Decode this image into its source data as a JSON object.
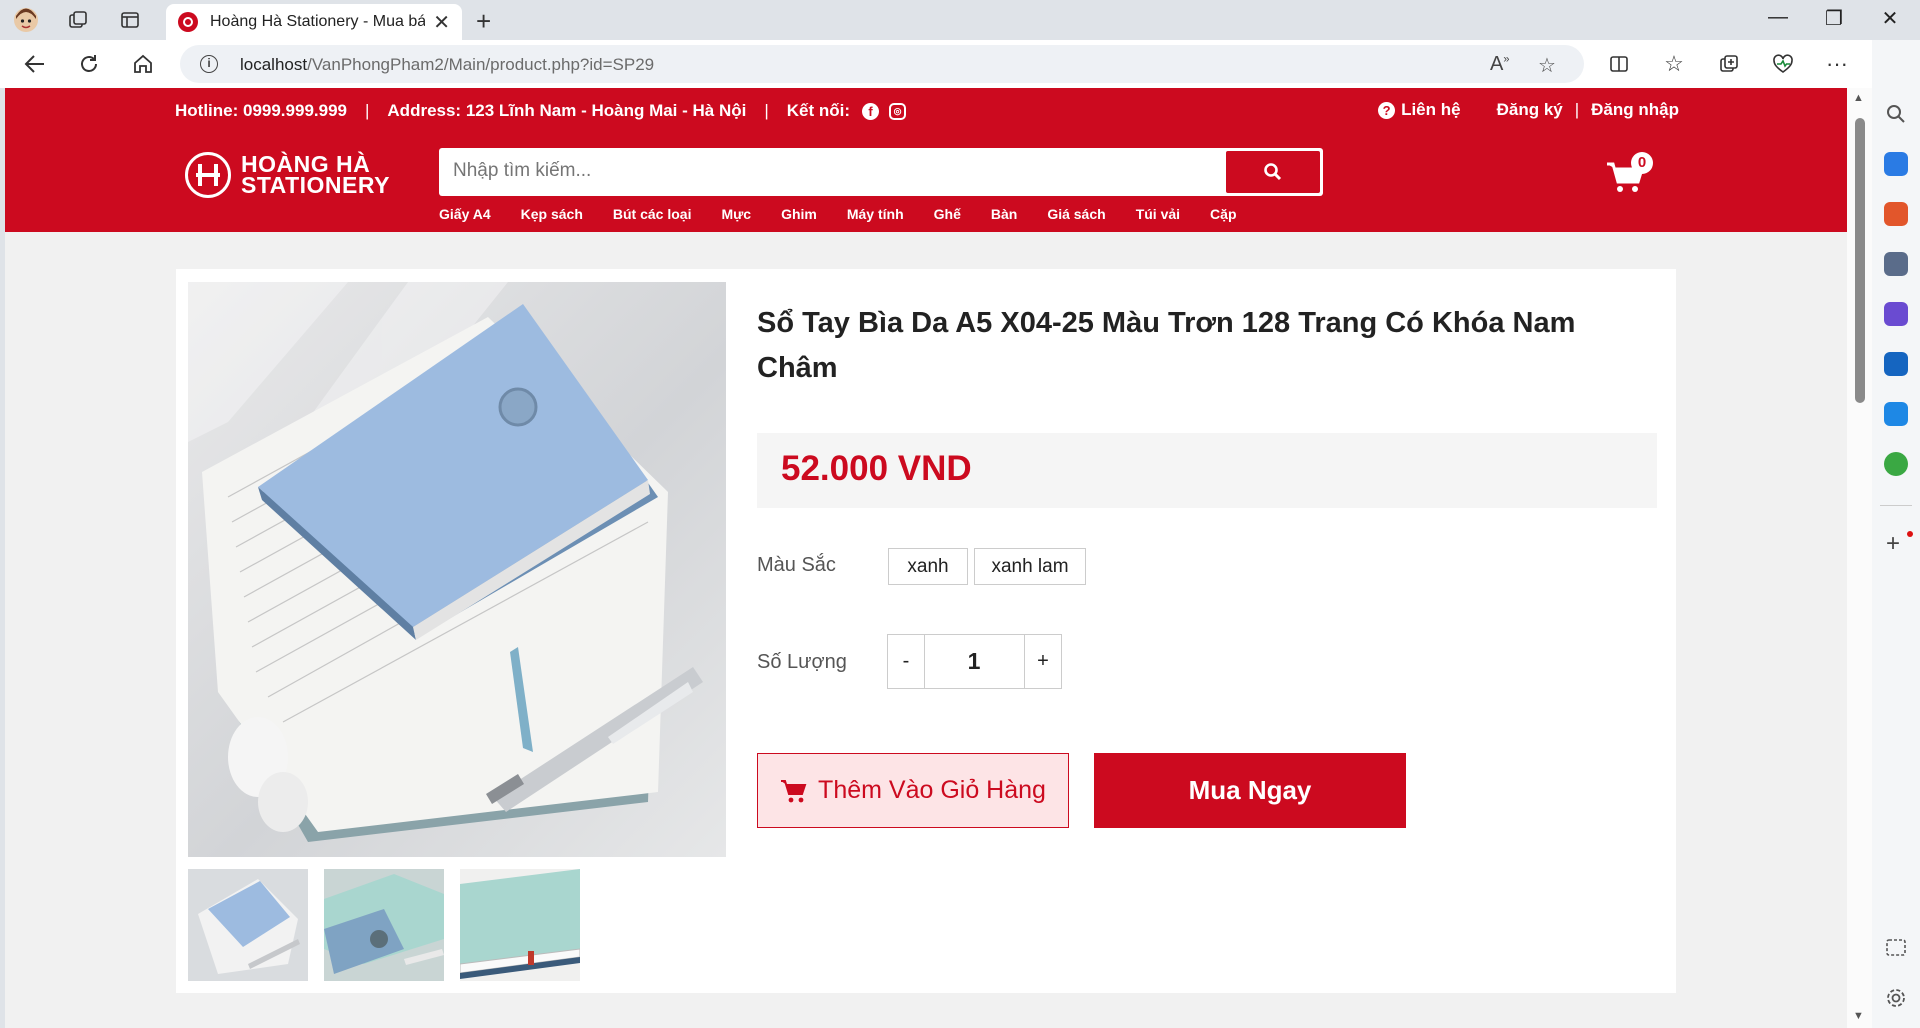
{
  "browser": {
    "tab_title": "Hoàng Hà Stationery - Mua bán",
    "url_host": "localhost",
    "url_path": "/VanPhongPham2/Main/product.php?id=SP29"
  },
  "topbar": {
    "hotline": "Hotline: 0999.999.999",
    "address": "Address: 123 Lĩnh Nam - Hoàng Mai - Hà Nội",
    "connect_label": "Kết nối:",
    "contact": "Liên hệ",
    "register": "Đăng ký",
    "login": "Đăng nhập"
  },
  "logo": {
    "line1": "HOÀNG HÀ",
    "line2": "STATIONERY"
  },
  "search": {
    "placeholder": "Nhập tìm kiếm..."
  },
  "cart": {
    "count": "0"
  },
  "categories": [
    "Giấy A4",
    "Kẹp sách",
    "Bút các loại",
    "Mực",
    "Ghim",
    "Máy tính",
    "Ghế",
    "Bàn",
    "Giá sách",
    "Túi vải",
    "Cặp"
  ],
  "product": {
    "title": "Sổ Tay Bìa Da A5 X04-25 Màu Trơn 128 Trang Có Khóa Nam Châm",
    "price": "52.000 VND",
    "color_label": "Màu Sắc",
    "colors": [
      "xanh",
      "xanh lam"
    ],
    "qty_label": "Số Lượng",
    "qty_minus": "-",
    "qty_value": "1",
    "qty_plus": "+",
    "add_to_cart": "Thêm Vào Giỏ Hàng",
    "buy_now": "Mua Ngay"
  },
  "colors": {
    "brand_red": "#cc0a1f",
    "notebook_blue": "#8fb3d9",
    "notebook_mint": "#a9d6cf"
  }
}
